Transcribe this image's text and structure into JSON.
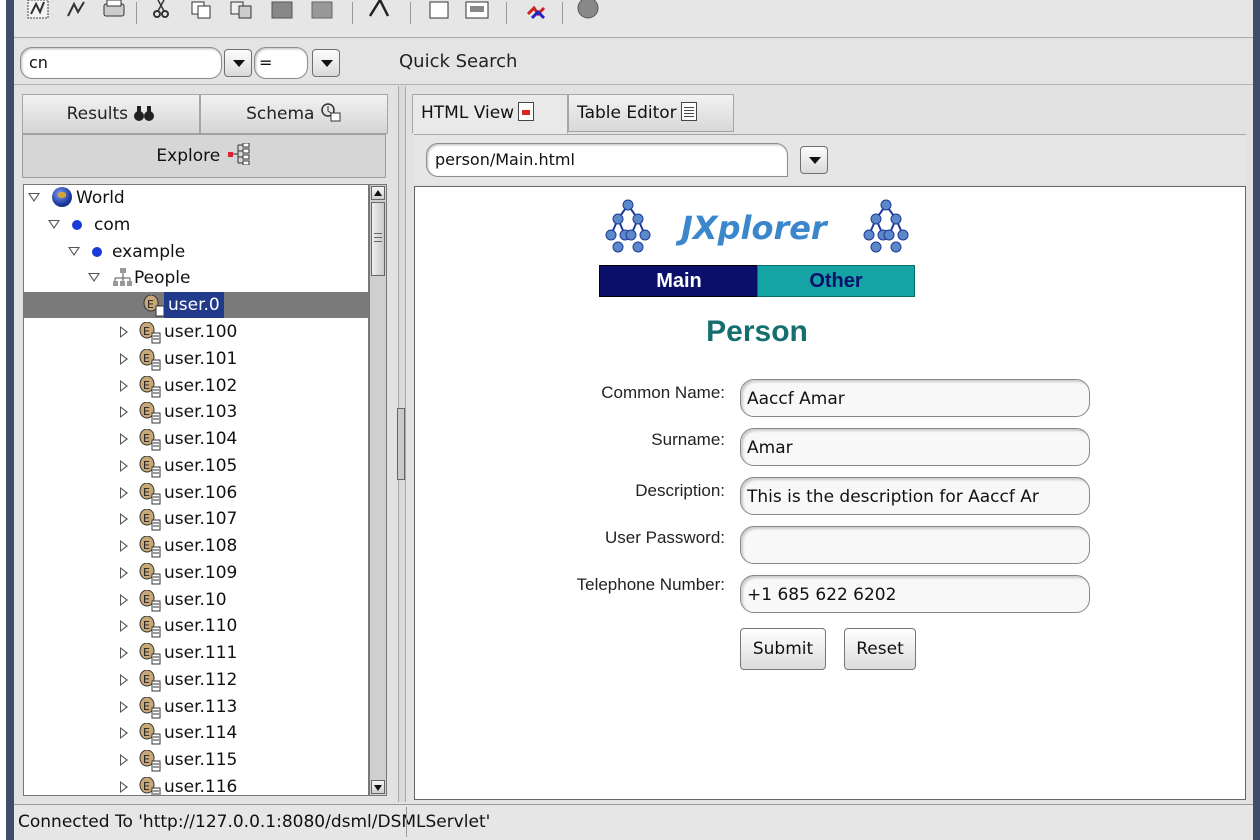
{
  "quick_search": {
    "attribute_value": "cn",
    "operator_value": "=",
    "label": "Quick Search"
  },
  "left_tabs": {
    "results": "Results",
    "schema": "Schema",
    "explore": "Explore"
  },
  "tree": {
    "root": "World",
    "nodes": [
      {
        "label": "com"
      },
      {
        "label": "example"
      },
      {
        "label": "People"
      }
    ],
    "selected_user": "user.0",
    "users": [
      "user.100",
      "user.101",
      "user.102",
      "user.103",
      "user.104",
      "user.105",
      "user.106",
      "user.107",
      "user.108",
      "user.109",
      "user.10",
      "user.110",
      "user.111",
      "user.112",
      "user.113",
      "user.114",
      "user.115",
      "user.116"
    ]
  },
  "right_tabs": {
    "html_view": "HTML View",
    "table_editor": "Table Editor"
  },
  "template_select": {
    "value": "person/Main.html"
  },
  "html_page": {
    "logo_text": "JXplorer",
    "nav_main": "Main",
    "nav_other": "Other",
    "title": "Person",
    "fields": [
      {
        "label": "Common Name:",
        "value": "Aaccf Amar"
      },
      {
        "label": "Surname:",
        "value": "Amar"
      },
      {
        "label": "Description:",
        "value": "This is the description for Aaccf Ar"
      },
      {
        "label": "User Password:",
        "value": ""
      },
      {
        "label": "Telephone Number:",
        "value": "+1 685 622 6202"
      }
    ],
    "submit_label": "Submit",
    "reset_label": "Reset",
    "colors": {
      "nav_main_bg": "#0c0f6a",
      "nav_other_bg": "#15a4a4",
      "title_color": "#156f6f",
      "logo_color": "#3c86cc"
    }
  },
  "status": {
    "text": "Connected To 'http://127.0.0.1:8080/dsml/DSMLServlet'"
  },
  "toolbar_icons": [
    "connect-icon",
    "disconnect-icon",
    "print-icon",
    "cut-icon",
    "copy-icon",
    "copy-dn-icon",
    "paste-icon",
    "paste-alias-icon",
    "delete-icon",
    "new-entry-icon",
    "rename-icon",
    "refresh-icon",
    "stop-icon"
  ]
}
